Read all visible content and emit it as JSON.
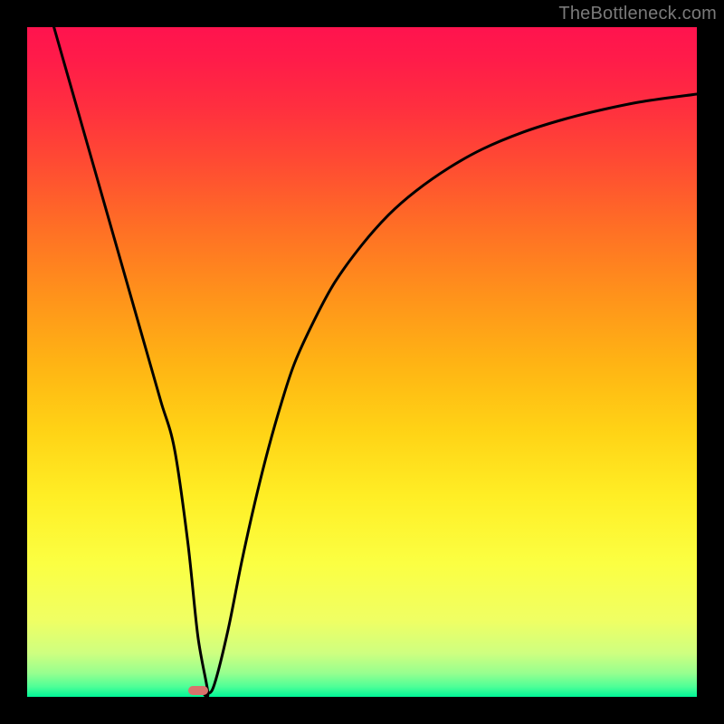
{
  "watermark": "TheBottleneck.com",
  "chart_data": {
    "type": "line",
    "title": "",
    "xlabel": "",
    "ylabel": "",
    "xlim": [
      0,
      100
    ],
    "ylim": [
      0,
      100
    ],
    "grid": false,
    "series": [
      {
        "name": "curve",
        "x": [
          4,
          6,
          8,
          10,
          12,
          14,
          16,
          18,
          20,
          22,
          24,
          25.5,
          27,
          26,
          27,
          28,
          30,
          32,
          34,
          36,
          38,
          40,
          43,
          46,
          50,
          54,
          58,
          63,
          68,
          74,
          80,
          86,
          92,
          100
        ],
        "y": [
          100,
          93,
          86,
          79,
          72,
          65,
          58,
          51,
          44,
          37,
          23,
          9,
          0.5,
          1,
          0.5,
          2,
          10,
          20,
          29,
          37,
          44,
          50,
          56.5,
          62,
          67.5,
          72,
          75.5,
          79,
          81.8,
          84.3,
          86.2,
          87.7,
          88.9,
          90
        ]
      }
    ],
    "marker": {
      "x": 25.5,
      "y": 0.9,
      "color": "#d8736c"
    },
    "background_gradient": {
      "stops": [
        {
          "offset": 0.0,
          "color": "#ff134e"
        },
        {
          "offset": 0.05,
          "color": "#ff1c49"
        },
        {
          "offset": 0.12,
          "color": "#ff2f3f"
        },
        {
          "offset": 0.2,
          "color": "#ff4a33"
        },
        {
          "offset": 0.3,
          "color": "#ff6f25"
        },
        {
          "offset": 0.4,
          "color": "#ff921b"
        },
        {
          "offset": 0.5,
          "color": "#ffb314"
        },
        {
          "offset": 0.6,
          "color": "#ffd215"
        },
        {
          "offset": 0.7,
          "color": "#ffee25"
        },
        {
          "offset": 0.8,
          "color": "#fbff42"
        },
        {
          "offset": 0.885,
          "color": "#f0ff63"
        },
        {
          "offset": 0.935,
          "color": "#ceff80"
        },
        {
          "offset": 0.965,
          "color": "#96ff8f"
        },
        {
          "offset": 0.985,
          "color": "#4dff97"
        },
        {
          "offset": 1.0,
          "color": "#00f597"
        }
      ]
    }
  }
}
